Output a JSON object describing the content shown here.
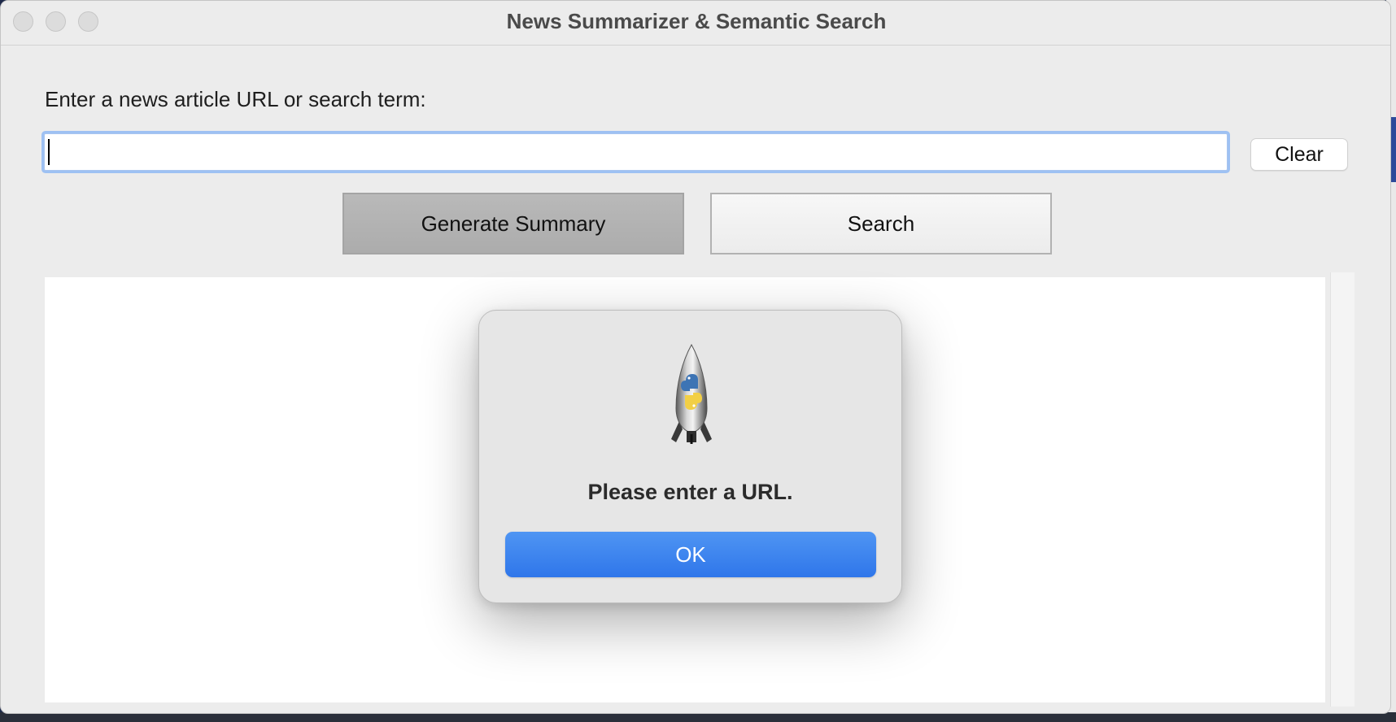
{
  "window": {
    "title": "News Summarizer & Semantic Search"
  },
  "form": {
    "prompt_label": "Enter a news article URL or search term:",
    "input_value": "",
    "clear_label": "Clear",
    "generate_label": "Generate Summary",
    "search_label": "Search"
  },
  "output": {
    "text": ""
  },
  "dialog": {
    "icon": "python-launcher-rocket-icon",
    "message": "Please enter a URL.",
    "ok_label": "OK"
  },
  "colors": {
    "accent": "#3b82f6",
    "window_bg": "#ececec",
    "focus_ring": "#9ec1f3"
  }
}
